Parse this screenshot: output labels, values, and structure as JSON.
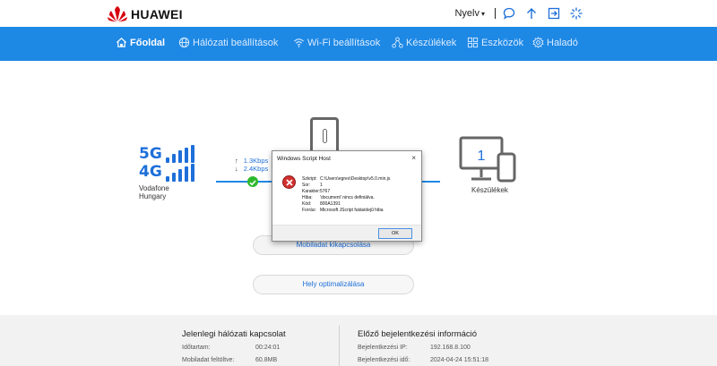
{
  "header": {
    "brand": "HUAWEI",
    "language_label": "Nyelv",
    "icons": [
      "chat-icon",
      "update-arrow-icon",
      "logout-icon",
      "loading-icon"
    ]
  },
  "nav": {
    "items": [
      {
        "label": "Főoldal",
        "icon": "home-icon",
        "active": true
      },
      {
        "label": "Hálózati beállítások",
        "icon": "globe-icon"
      },
      {
        "label": "Wi-Fi beállítások",
        "icon": "wifi-icon"
      },
      {
        "label": "Készülékek",
        "icon": "devices-icon"
      },
      {
        "label": "Eszközök",
        "icon": "tools-icon"
      },
      {
        "label": "Haladó",
        "icon": "gear-icon"
      }
    ]
  },
  "status": {
    "gen_5g": "5G",
    "gen_4g": "4G",
    "carrier": "Vodafone Hungary",
    "upload_rate": "1.3Kbps",
    "download_rate": "2.4Kbps",
    "device_count": "1",
    "devices_label": "Készülékek"
  },
  "buttons": {
    "mobile_disconnect": "Mobiladat kikapcsolása",
    "optimize": "Hely optimalizálása"
  },
  "dialog": {
    "title": "Windows Script Host",
    "close": "×",
    "rows": [
      {
        "k": "Szkript:",
        "v": "C:\\Users\\egres\\Desktop\\v5.0.min.js"
      },
      {
        "k": "Sor:",
        "v": "1"
      },
      {
        "k": "Karakter:",
        "v": "5767"
      },
      {
        "k": "Hiba:",
        "v": "'document' nincs definiálva."
      },
      {
        "k": "Kód:",
        "v": "800A1391"
      },
      {
        "k": "Forrás:",
        "v": "Microsoft JScript futásidejű hiba"
      }
    ],
    "ok_label": "OK"
  },
  "footer": {
    "current": {
      "title": "Jelenlegi hálózati kapcsolat",
      "rows": [
        {
          "k": "Időtartam:",
          "v": "00:24:01"
        },
        {
          "k": "Mobiladat feltöltve:",
          "v": "60.8MB"
        }
      ]
    },
    "previous": {
      "title": "Előző bejelentkezési információ",
      "rows": [
        {
          "k": "Bejelentkezési IP:",
          "v": "192.168.8.100"
        },
        {
          "k": "Bejelentkezési idő:",
          "v": "2024-04-24 15:51:18"
        }
      ]
    }
  },
  "colors": {
    "nav_bg": "#1e88e5",
    "accent": "#1e6fd9",
    "ok_green": "#2eb82e",
    "error_red": "#d32f2f"
  }
}
